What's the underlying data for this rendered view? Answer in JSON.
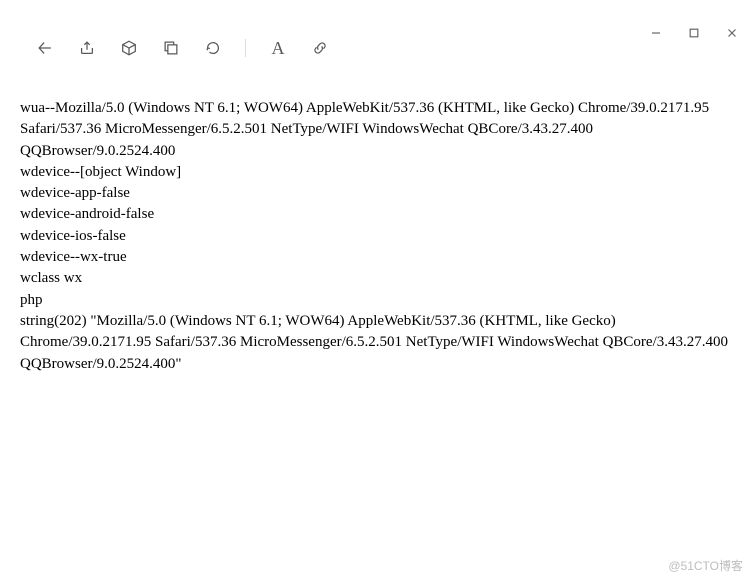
{
  "content": {
    "lines": [
      "wua--Mozilla/5.0 (Windows NT 6.1; WOW64) AppleWebKit/537.36 (KHTML, like Gecko) Chrome/39.0.2171.95 Safari/537.36 MicroMessenger/6.5.2.501 NetType/WIFI WindowsWechat QBCore/3.43.27.400 QQBrowser/9.0.2524.400",
      "wdevice--[object Window]",
      "wdevice-app-false",
      "wdevice-android-false",
      "wdevice-ios-false",
      "wdevice--wx-true",
      "wclass wx",
      "php",
      "string(202) \"Mozilla/5.0 (Windows NT 6.1; WOW64) AppleWebKit/537.36 (KHTML, like Gecko) Chrome/39.0.2171.95 Safari/537.36 MicroMessenger/6.5.2.501 NetType/WIFI WindowsWechat QBCore/3.43.27.400 QQBrowser/9.0.2524.400\""
    ]
  },
  "toolbar": {
    "font_label": "A"
  },
  "watermark": "@51CTO博客"
}
